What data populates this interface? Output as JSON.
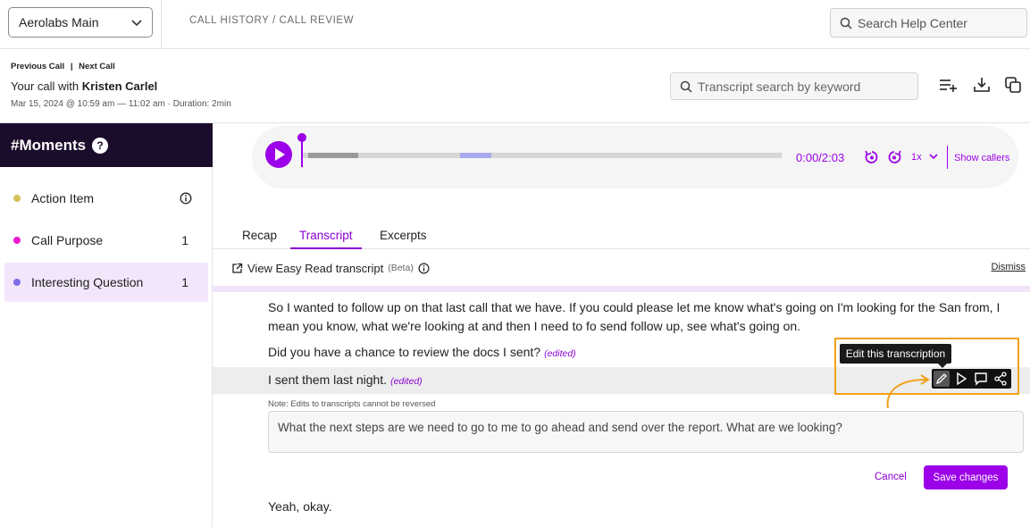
{
  "topbar": {
    "org_select": "Aerolabs Main",
    "breadcrumb": "CALL HISTORY / CALL REVIEW",
    "help_search_placeholder": "Search Help Center"
  },
  "call": {
    "previous": "Previous Call",
    "separator": "|",
    "next": "Next Call",
    "title_prefix": "Your call with",
    "contact": "Kristen Carlel",
    "meta": "Mar 15, 2024 @ 10:59 am — 11:02 am · Duration: 2min",
    "transcript_search_placeholder": "Transcript search by keyword"
  },
  "moments": {
    "title": "#Moments",
    "help_badge": "?",
    "items": [
      {
        "label": "Action Item",
        "count": "",
        "color": "#d4c25a"
      },
      {
        "label": "Call Purpose",
        "count": "1",
        "color": "#e81ad1"
      },
      {
        "label": "Interesting Question",
        "count": "1",
        "color": "#7b6ee8"
      }
    ]
  },
  "player": {
    "time": "0:00/2:03",
    "speed": "1x",
    "show_callers": "Show callers",
    "progress": 0.0
  },
  "tabs": [
    "Recap",
    "Transcript",
    "Excerpts"
  ],
  "active_tab": "Transcript",
  "easy_read": {
    "label": "View Easy Read transcript",
    "beta": "(Beta)",
    "dismiss": "Dismiss"
  },
  "transcript": {
    "line1": "So I wanted to follow up on that last call that we have. If you could please let me know what's going on I'm looking for the San from, I mean you know, what we're looking at and then I need to fo send follow up, see what's going on.",
    "line2": "Did you have a chance to review the docs I sent?",
    "line3": "I sent them last night.",
    "edited_tag": "(edited)",
    "note": "Note: Edits to transcripts cannot be reversed",
    "edit_value": "What the next steps are we need to go to me to go ahead and send over the report. What are we looking?",
    "cancel": "Cancel",
    "save": "Save changes",
    "line4": "Yeah, okay."
  },
  "tooltip": "Edit this transcription",
  "colors": {
    "accent": "#9b00e8",
    "highlight_box": "#f3a11a",
    "moments_header": "#1c0c2c"
  }
}
